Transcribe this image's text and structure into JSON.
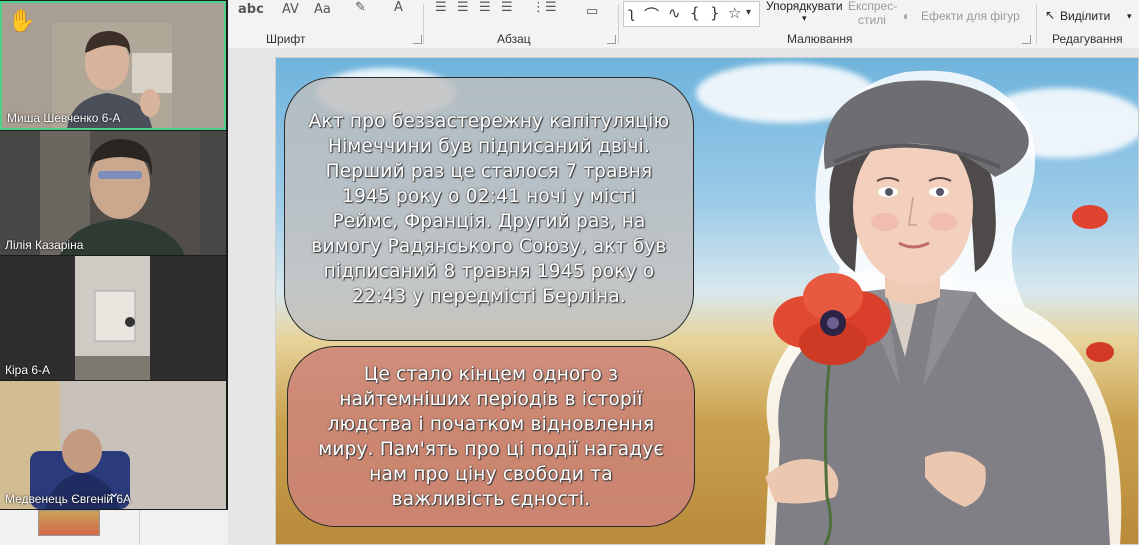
{
  "ribbon": {
    "groups": {
      "font": "Шрифт",
      "paragraph": "Абзац",
      "drawing": "Малювання",
      "editing": "Редагування"
    },
    "arrange": "Упорядкувати",
    "quick_styles_1": "Експрес-",
    "quick_styles_2": "стилі",
    "shape_effects": "Ефекти для фігур",
    "select": "Виділити",
    "strike_label": "abc",
    "spacing_label": "AV",
    "case_label": "Aa",
    "color_label": "A"
  },
  "participants": [
    {
      "name": "Миша Шевченко 6-А"
    },
    {
      "name": "Лілія Казаріна"
    },
    {
      "name": "Кіра 6-А"
    },
    {
      "name": "Медвенець Євгеній 6А"
    }
  ],
  "slide": {
    "text_1": "Акт про беззастережну капітуляцію Німеччини був підписаний двічі. Перший раз це сталося 7 травня 1945 року о 02:41 ночі у місті Реймс, Франція. Другий раз, на вимогу Радянського Союзу, акт був підписаний 8 травня 1945 року о 22:43 у передмісті Берліна.",
    "text_2": "Це стало кінцем одного з найтемніших періодів в історії людства і початком відновлення миру. Пам'ять про ці події нагадує нам про ціну свободи та важливість єдності."
  },
  "colors": {
    "active_speaker_border": "#4cd08a",
    "bubble_top": "#bebebe",
    "bubble_bottom": "#cd8278"
  }
}
